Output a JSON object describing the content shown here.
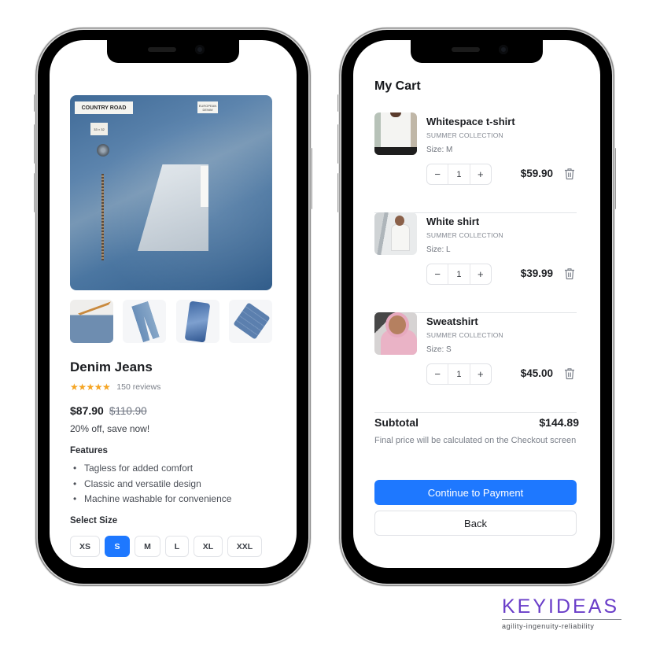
{
  "product_screen": {
    "hero_image": {
      "label_brand": "COUNTRY ROAD",
      "label_secondary": "EUROPEAN DENIM",
      "size_tag": "33 × 32"
    },
    "thumbnails": [
      {
        "name": "jeans-on-hanger"
      },
      {
        "name": "jeans-flat-lay"
      },
      {
        "name": "jeans-stack-twisted"
      },
      {
        "name": "jeans-folded"
      }
    ],
    "title": "Denim Jeans",
    "rating": {
      "stars": 5,
      "max": 5,
      "stars_glyphs": "★★★★★",
      "reviews": "150 reviews"
    },
    "price": "$87.90",
    "original_price": "$110.90",
    "discount_text": "20% off, save now!",
    "features_heading": "Features",
    "features": [
      "Tagless for added comfort",
      "Classic and versatile design",
      "Machine washable for convenience"
    ],
    "size_heading": "Select Size",
    "sizes": [
      "XS",
      "S",
      "M",
      "L",
      "XL",
      "XXL"
    ],
    "selected_size": "S"
  },
  "cart_screen": {
    "title": "My Cart",
    "items": [
      {
        "name": "Whitespace t-shirt",
        "collection": "SUMMER COLLECTION",
        "size": "Size: M",
        "quantity": "1",
        "price": "$59.90",
        "image": "white-tshirt"
      },
      {
        "name": "White shirt",
        "collection": "SUMMER COLLECTION",
        "size": "Size: L",
        "quantity": "1",
        "price": "$39.99",
        "image": "white-shirt"
      },
      {
        "name": "Sweatshirt",
        "collection": "SUMMER COLLECTION",
        "size": "Size: S",
        "quantity": "1",
        "price": "$45.00",
        "image": "pink-sweatshirt"
      }
    ],
    "stepper": {
      "minus": "−",
      "plus": "+"
    },
    "subtotal_label": "Subtotal",
    "subtotal_value": "$144.89",
    "subtotal_note": "Final price will be calculated on the Checkout screen",
    "primary_button": "Continue to Payment",
    "secondary_button": "Back"
  },
  "brand": {
    "name": "KEYIDEAS",
    "tagline": "agility-ingenuity-reliability"
  },
  "colors": {
    "accent": "#1e78ff",
    "star": "#f5a524",
    "brand": "#6a3ec9"
  }
}
